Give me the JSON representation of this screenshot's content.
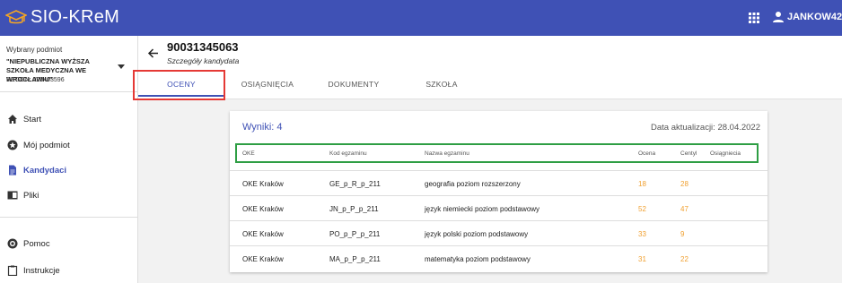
{
  "app": {
    "title": "SIO-KReM",
    "user": "JANKOW42"
  },
  "sidebar": {
    "label": "Wybrany podmiot",
    "entity_name": "\"NIEPUBLICZNA WYŻSZA SZKOŁA MEDYCZNA WE WROCŁAWIU\"",
    "regon": "REGON: 020403596",
    "items": [
      {
        "label": "Start",
        "icon": "home-icon"
      },
      {
        "label": "Mój podmiot",
        "icon": "star-badge-icon"
      },
      {
        "label": "Kandydaci",
        "icon": "document-icon"
      },
      {
        "label": "Pliki",
        "icon": "files-icon"
      },
      {
        "label": "Pomoc",
        "icon": "help-icon"
      },
      {
        "label": "Instrukcje",
        "icon": "clipboard-icon"
      }
    ]
  },
  "candidate": {
    "id": "90031345063",
    "subtitle": "Szczegóły kandydata"
  },
  "tabs": [
    "OCENY",
    "OSIĄGNIĘCIA",
    "DOKUMENTY",
    "SZKOŁA"
  ],
  "results": {
    "title": "Wyniki: 4",
    "updated": "Data aktualizacji: 28.04.2022",
    "columns": [
      "OKE",
      "Kod egzaminu",
      "Nazwa egzaminu",
      "Ocena",
      "Centyl",
      "Osiągniecia"
    ],
    "rows": [
      [
        "OKE Kraków",
        "GE_p_R_p_211",
        "geografia poziom rozszerzony",
        "18",
        "28",
        ""
      ],
      [
        "OKE Kraków",
        "JN_p_P_p_211",
        "język niemiecki poziom podstawowy",
        "52",
        "47",
        ""
      ],
      [
        "OKE Kraków",
        "PO_p_P_p_211",
        "język polski poziom podstawowy",
        "33",
        "9",
        ""
      ],
      [
        "OKE Kraków",
        "MA_p_P_p_211",
        "matematyka poziom podstawowy",
        "31",
        "22",
        ""
      ]
    ]
  },
  "colors": {
    "primary": "#3f51b5",
    "accent": "#f0a030",
    "highlight_red": "#e53935",
    "highlight_green": "#2e9e44"
  }
}
